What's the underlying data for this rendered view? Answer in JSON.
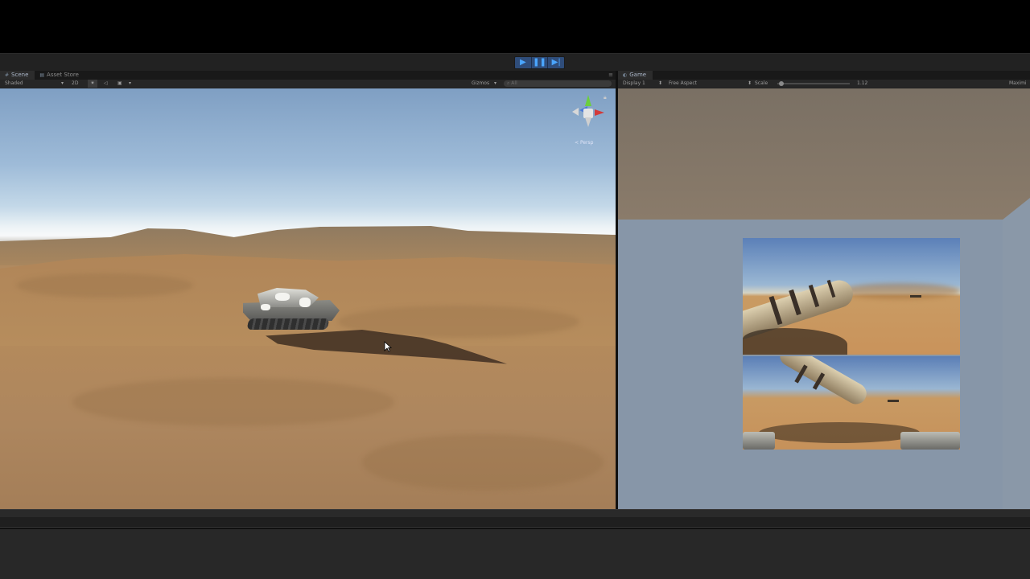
{
  "toolbar": {
    "play_icon": "play-icon",
    "pause_icon": "pause-icon",
    "step_icon": "step-icon",
    "accent": "#4aa6ff"
  },
  "scene": {
    "tabs": [
      {
        "label": "Scene",
        "icon": "scene-icon"
      },
      {
        "label": "Asset Store",
        "icon": "store-icon"
      }
    ],
    "shading_mode": "Shaded",
    "mode_2d": "2D",
    "gizmos_label": "Gizmos",
    "search_placeholder": "All",
    "projection_label": "Persp"
  },
  "game": {
    "tab_label": "Game",
    "display": "Display 1",
    "aspect": "Free Aspect",
    "scale_label": "Scale",
    "scale_value": "1.12",
    "maximize_label": "Maximi"
  },
  "colors": {
    "sky_top": "#7f9fc3",
    "sand": "#b48a5c",
    "game_background": "#8796a8"
  }
}
